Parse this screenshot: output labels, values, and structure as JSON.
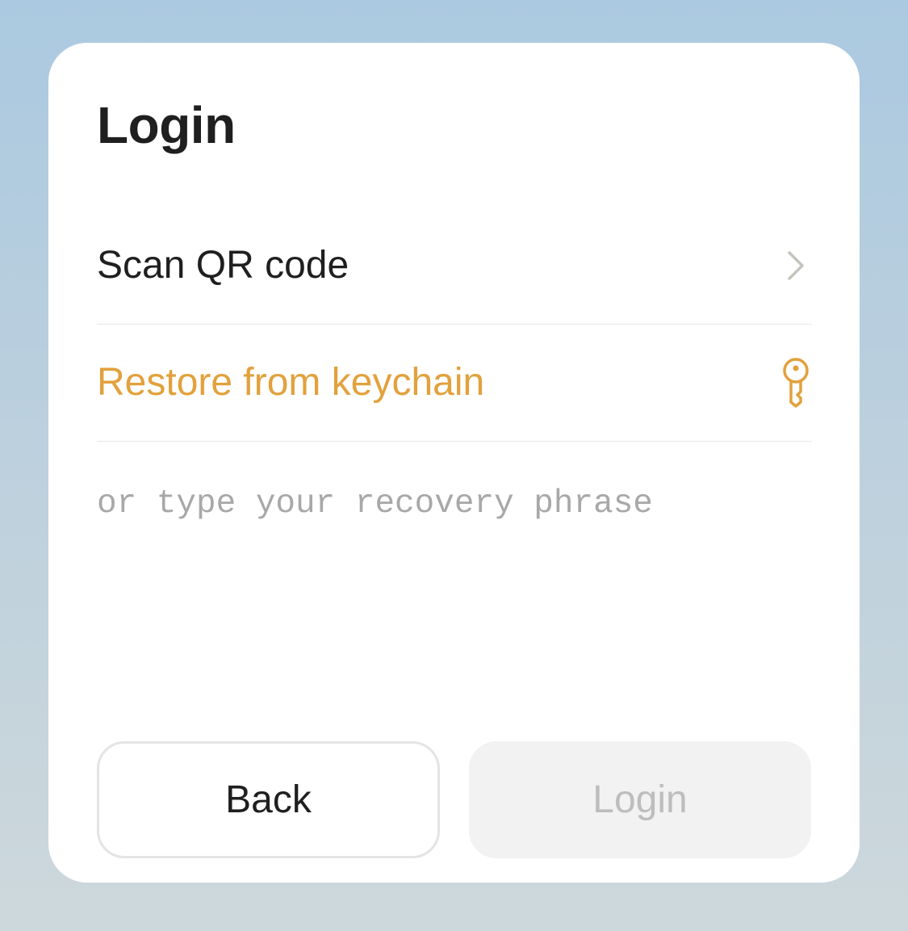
{
  "dialog": {
    "title": "Login"
  },
  "options": {
    "scan_qr": {
      "label": "Scan QR code",
      "icon": "chevron-right-icon"
    },
    "restore_keychain": {
      "label": "Restore from keychain",
      "icon": "key-icon"
    }
  },
  "recovery": {
    "placeholder": "or type your recovery phrase",
    "value": ""
  },
  "buttons": {
    "back_label": "Back",
    "login_label": "Login"
  },
  "colors": {
    "accent": "#e2a13c",
    "text": "#1f1f1f",
    "placeholder": "#a8a8a8",
    "disabled_text": "#bdbdbd",
    "disabled_bg": "#f2f2f2"
  }
}
